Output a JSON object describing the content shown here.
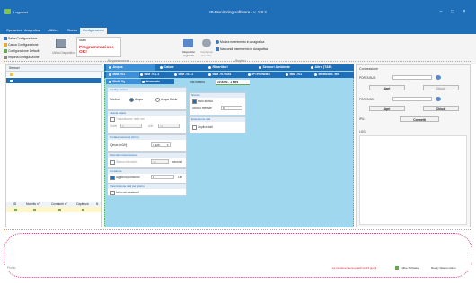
{
  "window": {
    "app_name": "Logoport",
    "title": "IP-Monitoring software - v. 1.8.2",
    "min": "–",
    "max": "□",
    "close": "×"
  },
  "menu": {
    "items": [
      "Operazioni",
      "Anagrafica",
      "Utilities",
      "Storico",
      "Configurazione"
    ],
    "active_index": 4
  },
  "ribbon": {
    "save": "Salva Configurazione",
    "load": "Carica Configurazione",
    "default": "Configurazione Default",
    "import": "Importa configurazione",
    "utility_label": "Utilita Dispositivo",
    "stato_label": "Stato",
    "stato_value": "Programmazione OK!",
    "group_prog": "Programmazione",
    "dispositivi": "Dispositivi registrati",
    "configura": "Configura sito Ethe",
    "mostra": "Mostra inserimento in Anagrafica",
    "nascondi": "Nascondi inserimento in Anagrafica",
    "group_reg": "Registro"
  },
  "left_grid": {
    "top_header": "Sensori",
    "columns": [
      "ID",
      "Modello n°",
      "Contatore n°",
      "Capienza",
      "N"
    ]
  },
  "tabs_row1": [
    "Acqua",
    "Calore",
    "Ripartitori",
    "Sensori Ambiente",
    "Altro (T&E)"
  ],
  "tabs_row2": [
    "IBM 701",
    "IBM 701.1",
    "IBM 701.1",
    "IBM 707/054",
    "IPTRONNET",
    "IBM 701",
    "Multicont. MS"
  ],
  "tabs_row3": [
    "Multi Sy",
    "Avanzate"
  ],
  "left_form": {
    "config_hdr": "Configurazione",
    "medium_label": "Medium",
    "medium_opt1": "Acqua",
    "medium_opt2": "Acqua Calda",
    "fascia_hdr": "Fascia oraria",
    "fascia_chk": "Trasmissione nelle ore",
    "dalle_label": "Dalle",
    "dalle_value": "0",
    "alle_label": "Alle",
    "alle_value": "23",
    "portata_hdr": "Portata massima (l/min)",
    "qmax_label": "Qmax [m3/h]",
    "qmax_value": "3,125",
    "intervallo_hdr": "Intervallo trasmissione",
    "stacca_label": "Stacca intervallo",
    "stacca_value": "20",
    "stacca_unit": "secondi",
    "contatore_hdr": "Contatore",
    "aggiorna_label": "Aggiorna consumo",
    "aggiorna_value": "0",
    "aggiorna_unit": "Litri",
    "trasmissione_hdr": "Trasmissione dati per giorno",
    "trasmissione_chk": "Invia nei weekend"
  },
  "mid_form": {
    "vita_label": "Vita batteria",
    "vita_value": "10 Anni - 1 Mes",
    "storico_hdr": "Storico",
    "invio_label": "Invio storico",
    "storico_mensile": "Storico mensile",
    "storico_value": "0",
    "estensione_hdr": "Estensione dati",
    "duplica_label": "Duplica dati"
  },
  "right_panel": {
    "title": "Connessione",
    "porta1_label": "PORTA BUS:",
    "apri1": "Apri",
    "chiudi1": "Chiudi",
    "porta2_label": "PORTA BS:",
    "apri2": "Apri",
    "chiudi2": "Chiudi",
    "ipu_label": "IPU:",
    "connetti": "Connetti",
    "log_label": "LOG"
  },
  "status": {
    "left_text": "Pronto",
    "red_text": "La versione llama qualcli ku 13 giorni",
    "mid_text": "Fdfue Software",
    "right_text": "Ready Stiama ultimo"
  },
  "colors": {
    "accent": "#1e6fb8",
    "panel_bg": "#9fd7ef",
    "status_red": "#d8262e",
    "stato_red": "#d8262e"
  }
}
